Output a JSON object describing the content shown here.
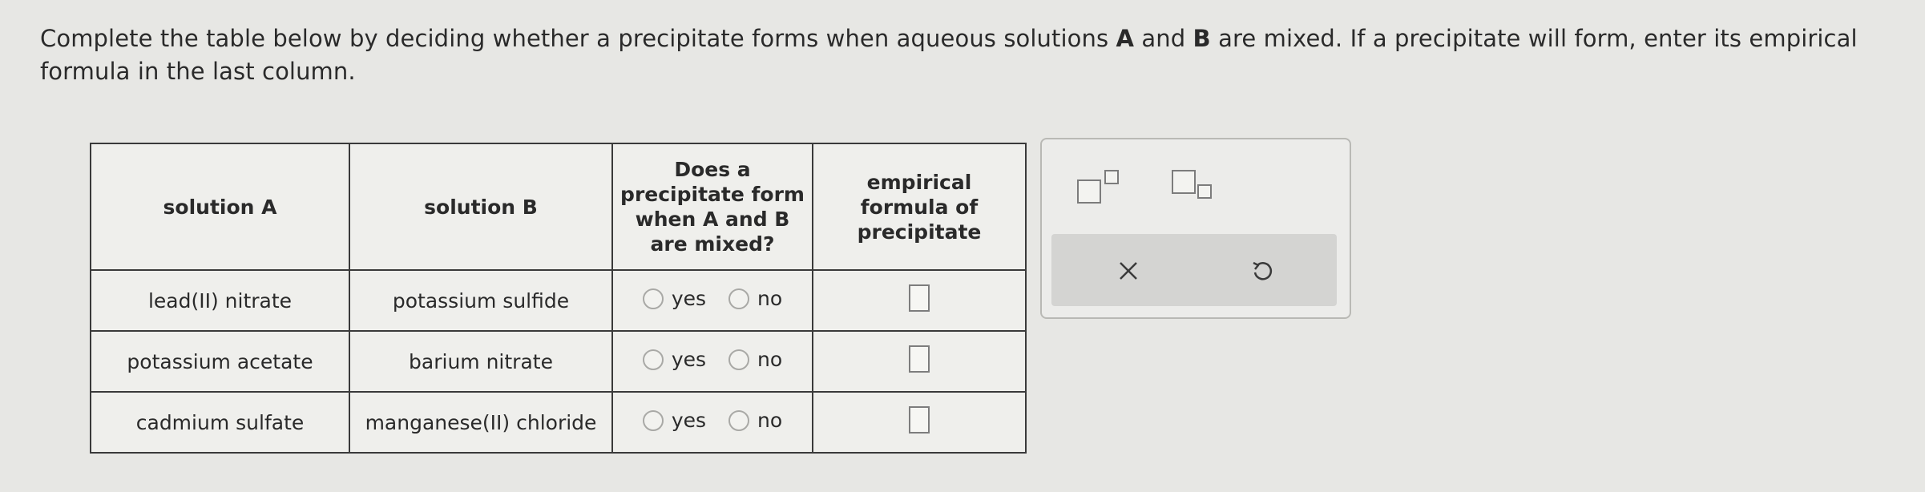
{
  "prompt": {
    "part1": "Complete the table below by deciding whether a precipitate forms when aqueous solutions ",
    "boldA": "A",
    "part2": " and ",
    "boldB": "B",
    "part3": " are mixed. If a precipitate will form, enter its empirical formula in the last column."
  },
  "table": {
    "headers": {
      "col1": "solution A",
      "col2": "solution B",
      "col3": "Does a precipitate form when A and B are mixed?",
      "col4": "empirical formula of precipitate"
    },
    "rows": [
      {
        "solution_a": "lead(II) nitrate",
        "solution_b": "potassium sulfide",
        "yes": "yes",
        "no": "no"
      },
      {
        "solution_a": "potassium acetate",
        "solution_b": "barium nitrate",
        "yes": "yes",
        "no": "no"
      },
      {
        "solution_a": "cadmium sulfate",
        "solution_b": "manganese(II) chloride",
        "yes": "yes",
        "no": "no"
      }
    ]
  },
  "palette": {
    "tools": [
      "superscript-icon",
      "subscript-icon",
      "clear-icon",
      "undo-icon"
    ]
  }
}
